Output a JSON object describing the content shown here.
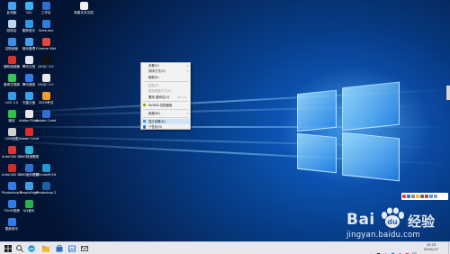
{
  "desktop": {
    "icons": [
      {
        "id": "computer",
        "label": "此电脑",
        "color": "#4aa3f0"
      },
      {
        "id": "qq",
        "label": "QQ",
        "color": "#3bb3f0"
      },
      {
        "id": "editor",
        "label": "工作站",
        "color": "#2f6fd0"
      },
      {
        "id": "folder",
        "label": "新建文本文档",
        "color": "#f0f0f0"
      },
      {
        "id": "recycle",
        "label": "回收站",
        "color": "#bcd7f0"
      },
      {
        "id": "kugou",
        "label": "酷狗音乐",
        "color": "#2b9be8"
      },
      {
        "id": "tool",
        "label": "Geek.exe",
        "color": "#2e7de0"
      },
      {
        "id": "control",
        "label": "控制面板",
        "color": "#3a8ee6"
      },
      {
        "id": "clean",
        "label": "驱动管理",
        "color": "#3fa0f0"
      },
      {
        "id": "chrome",
        "label": "Chrome Webn...",
        "color": "#e8453c"
      },
      {
        "id": "adobe",
        "label": "福昕阅读器",
        "color": "#d9342b"
      },
      {
        "id": "note",
        "label": "腾讯文档",
        "color": "#e0e6ee"
      },
      {
        "id": "black",
        "label": "JOOJC 2.0",
        "color": "#111111"
      },
      {
        "id": "video",
        "label": "爱奇艺视频",
        "color": "#3cc45a"
      },
      {
        "id": "docs",
        "label": "腾讯课堂",
        "color": "#2f7ce8"
      },
      {
        "id": "wps",
        "label": "JOOJC 2.0",
        "color": "#e8e8e8"
      },
      {
        "id": "photo",
        "label": "LiCE 2.0",
        "color": "#3a9be8"
      },
      {
        "id": "music",
        "label": "天翼云盘",
        "color": "#35a4f0"
      },
      {
        "id": "orange",
        "label": "2020考试",
        "color": "#f39c2b"
      },
      {
        "id": "wechat",
        "label": "微信",
        "color": "#2dc24a"
      },
      {
        "id": "kid",
        "label": "Adobe Photo",
        "color": "#e6e6e6"
      },
      {
        "id": "blue2",
        "label": "Adobe Creati",
        "color": "#2f6fd0"
      },
      {
        "id": "cam",
        "label": "CAD制图",
        "color": "#d0d0d0"
      },
      {
        "id": "pdf",
        "label": "Adobe Creati",
        "color": "#e02b2b"
      },
      {
        "id": "cad",
        "label": "AutoCAD 2014",
        "color": "#d23a3a"
      },
      {
        "id": "cadv",
        "label": "CAD快速看图",
        "color": "#2bb0d8"
      },
      {
        "id": "acrobat",
        "label": "AutoCAD 2020",
        "color": "#c9302c"
      },
      {
        "id": "ps",
        "label": "CAD迷你看图",
        "color": "#2b6fd0"
      },
      {
        "id": "edge",
        "label": "Microsoft Edge",
        "color": "#1f9ad6"
      },
      {
        "id": "ps2",
        "label": "Photoshop CC",
        "color": "#2f7ce8"
      },
      {
        "id": "people",
        "label": "PeopleEdge",
        "color": "#3aa0e8"
      },
      {
        "id": "ps3",
        "label": "Photoshop 2020",
        "color": "#1c5ea8"
      },
      {
        "id": "video2",
        "label": "TOOK视频",
        "color": "#2f7ce8"
      },
      {
        "id": "qqm",
        "label": "QQ音乐",
        "color": "#28b34a"
      },
      {
        "id": "music2",
        "label": "酷我音乐",
        "color": "#2f7ce8"
      }
    ]
  },
  "context_menu": {
    "items": [
      {
        "label": "查看(V)",
        "arrow": "›",
        "disabled": false
      },
      {
        "label": "排序方式(O)",
        "arrow": "›",
        "disabled": false
      },
      {
        "label": "刷新(E)",
        "disabled": false
      },
      {
        "label": "粘贴(P)",
        "disabled": true
      },
      {
        "label": "粘贴快捷方式(S)",
        "disabled": true
      },
      {
        "label": "撤消 重命名(U)",
        "shortcut": "Ctrl+Z",
        "disabled": false
      },
      {
        "label": "NVIDIA 控制面板",
        "icon_color": "#76b900",
        "disabled": false
      },
      {
        "label": "新建(W)",
        "arrow": "›",
        "disabled": false
      },
      {
        "label": "显示设置(D)",
        "icon_color": "#3a86d8",
        "disabled": false
      },
      {
        "label": "个性化(R)",
        "icon_color": "#2d6fc2",
        "disabled": false
      }
    ]
  },
  "watermark": {
    "brand_left": "Bai",
    "brand_right": "经验",
    "url": "jingyan.baidu.com"
  },
  "taskbar": {
    "apps": [
      {
        "id": "start",
        "color": "#1e1e1e"
      },
      {
        "id": "search",
        "color": "#444444"
      },
      {
        "id": "edge",
        "color": "#1f9ad6"
      },
      {
        "id": "file-explorer",
        "color": "#f2b52a"
      },
      {
        "id": "store",
        "color": "#2d6fc2"
      },
      {
        "id": "photos",
        "color": "#2d6fc2"
      },
      {
        "id": "mail",
        "color": "#1e1e1e"
      }
    ],
    "clock_time": "10:23",
    "clock_date": "2020/1/7"
  }
}
